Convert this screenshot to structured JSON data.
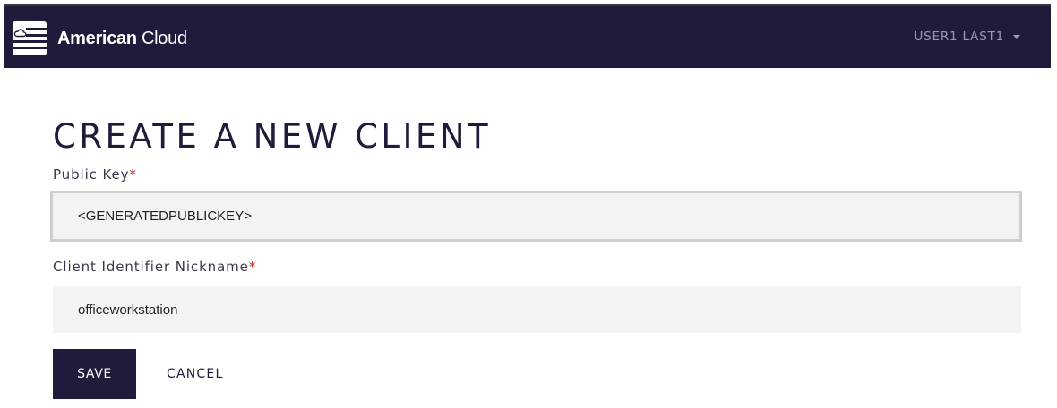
{
  "navbar": {
    "brand_bold": "American",
    "brand_rest": " Cloud",
    "logo_icon": "flag-cloud-logo",
    "user_name": "USER1 LAST1",
    "user_menu_icon": "caret-down-icon"
  },
  "page": {
    "title": "CREATE A NEW CLIENT"
  },
  "form": {
    "public_key": {
      "label": "Public Key",
      "required_mark": "*",
      "value": "<GENERATEDPUBLICKEY>"
    },
    "nickname": {
      "label": "Client Identifier Nickname",
      "required_mark": "*",
      "value": "officeworkstation"
    },
    "save_label": "SAVE",
    "cancel_label": "CANCEL"
  },
  "colors": {
    "navbar": "#1e1c3a",
    "primary_button": "#1e1c3a",
    "required": "#c21b1b",
    "input_bg": "#f3f3f3"
  }
}
